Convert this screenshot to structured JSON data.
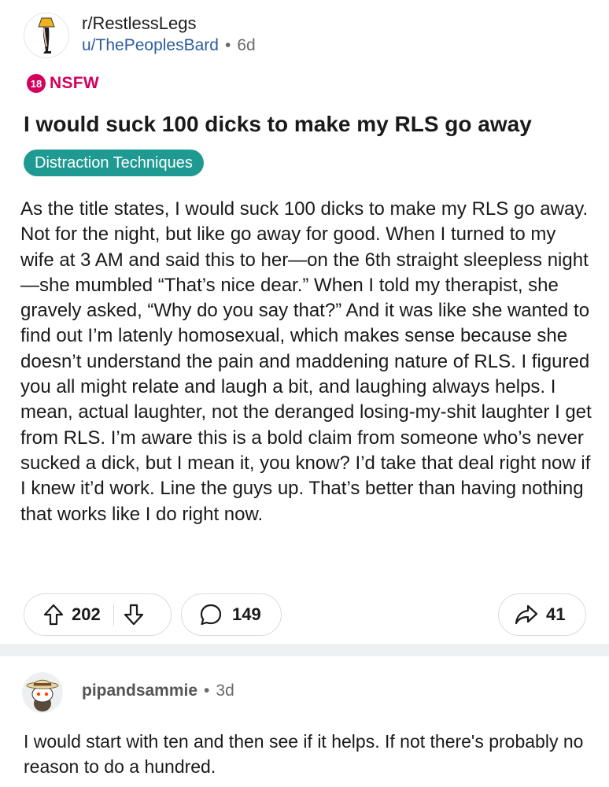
{
  "post": {
    "subreddit": "r/RestlessLegs",
    "author": "u/ThePeoplesBard",
    "separator": "•",
    "age": "6d",
    "nsfw_badge": "18",
    "nsfw_label": "NSFW",
    "title": "I would suck 100 dicks to make my RLS go away",
    "flair": "Distraction Techniques",
    "body": "As the title states, I would suck 100 dicks to make my RLS go away. Not for the night, but like go away for good. When I turned to my wife at 3 AM and said this to her—on the 6th straight sleepless night—she mumbled “That’s nice dear.” When I told my therapist, she gravely asked, “Why do you say that?” And it was like she wanted to find out I’m latenly homosexual, which makes sense because she doesn’t understand the pain and maddening nature of RLS. I figured you all might relate and laugh a bit, and laughing always helps. I mean, actual laughter, not the deranged losing-my-shit laughter I get from RLS. I’m aware this is a bold claim from someone who’s never sucked a dick, but I mean it, you know? I’d take that deal right now if I knew it’d work. Line the guys up. That’s better than having nothing that works like I do right now."
  },
  "actions": {
    "upvotes": "202",
    "comments": "149",
    "shares": "41"
  },
  "icons": {
    "upvote": "upvote-arrow-icon",
    "downvote": "downvote-arrow-icon",
    "comment": "comment-bubble-icon",
    "share": "share-arrow-icon",
    "subreddit_avatar": "leg-lamp-icon",
    "user_avatar": "snoo-cowboy-hat-icon"
  },
  "comment": {
    "author": "pipandsammie",
    "separator": "•",
    "age": "3d",
    "body": "I would start with ten and then see if it helps. If not there's probably no reason to do a hundred."
  },
  "colors": {
    "nsfw": "#d4005b",
    "flair": "#1f9a92",
    "author_link": "#2c5d9e",
    "separator_band": "#eef1f2"
  }
}
